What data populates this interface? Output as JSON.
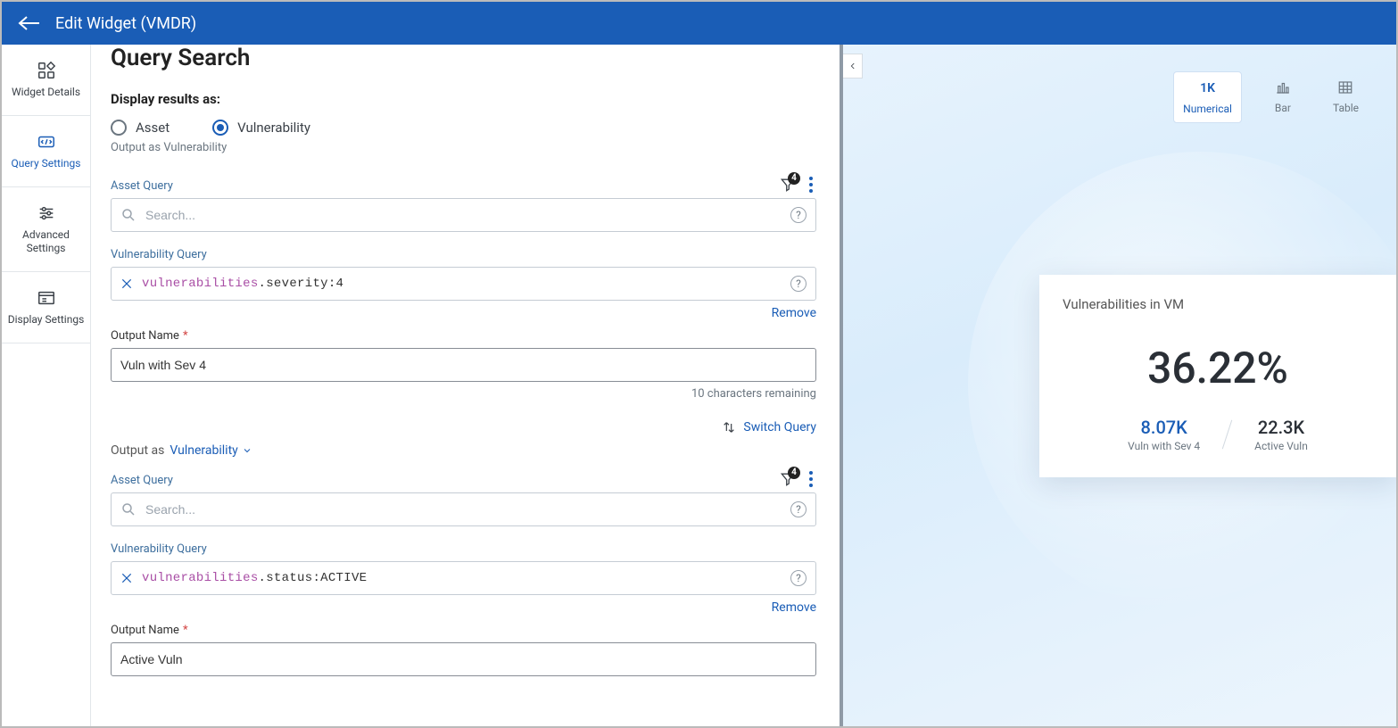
{
  "header": {
    "title": "Edit Widget (VMDR)"
  },
  "sidebar": {
    "items": [
      {
        "label": "Widget Details"
      },
      {
        "label": "Query Settings"
      },
      {
        "label": "Advanced Settings"
      },
      {
        "label": "Display Settings"
      }
    ],
    "active_index": 1
  },
  "form": {
    "page_title": "Query Search",
    "display_results_label": "Display results as:",
    "radio_asset": "Asset",
    "radio_vulnerability": "Vulnerability",
    "selected_radio": "Vulnerability",
    "output_as_note1": "Output as Vulnerability",
    "asset_query_label": "Asset Query",
    "asset_query1_placeholder": "Search...",
    "asset_query1_value": "",
    "filter_count1": "4",
    "vuln_query_label": "Vulnerability Query",
    "vuln_query1_ns": "vulnerabilities",
    "vuln_query1_attr": ".severity:",
    "vuln_query1_val": "4",
    "remove_label": "Remove",
    "output_name_label": "Output Name",
    "output_name1_value": "Vuln with Sev 4",
    "output_name1_hint": "10 characters remaining",
    "switch_query_label": "Switch Query",
    "output_as2_label": "Output as",
    "output_as2_value": "Vulnerability",
    "asset_query2_placeholder": "Search...",
    "asset_query2_value": "",
    "filter_count2": "4",
    "vuln_query2_ns": "vulnerabilities",
    "vuln_query2_attr": ".status:",
    "vuln_query2_val": "ACTIVE",
    "output_name2_value": "Active Vuln"
  },
  "preview": {
    "views": {
      "numerical_icon_text": "1K",
      "numerical": "Numerical",
      "bar": "Bar",
      "table": "Table",
      "active": "Numerical"
    },
    "card": {
      "title": "Vulnerabilities in VM",
      "percentage": "36.22%",
      "metric1_value": "8.07K",
      "metric1_label": "Vuln with Sev 4",
      "metric2_value": "22.3K",
      "metric2_label": "Active Vuln"
    }
  }
}
